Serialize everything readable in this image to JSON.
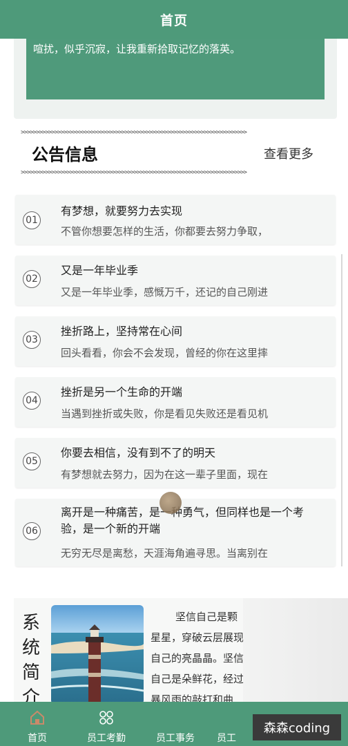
{
  "header": {
    "title": "首页"
  },
  "intro": {
    "text": "喧扰，似乎沉寂，让我重新拾取记忆的落英。"
  },
  "notice": {
    "arrows": ">>>>>>>>>>>>>>>>>>>>>>>>>>>>>>>>>>>>>>>>>>>>>>>>>>>>>>>>>>>>>>>>>>>>>>>>>>",
    "title": "公告信息",
    "more": "查看更多",
    "items": [
      {
        "num": "01",
        "title": "有梦想，就要努力去实现",
        "desc": "不管你想要怎样的生活，你都要去努力争取，"
      },
      {
        "num": "02",
        "title": "又是一年毕业季",
        "desc": "又是一年毕业季，感慨万千，还记的自己刚进"
      },
      {
        "num": "03",
        "title": "挫折路上，坚持常在心间",
        "desc": "回头看看，你会不会发现，曾经的你在这里摔"
      },
      {
        "num": "04",
        "title": "挫折是另一个生命的开端",
        "desc": "当遇到挫折或失败，你是看见失败还是看见机"
      },
      {
        "num": "05",
        "title": "你要去相信，没有到不了的明天",
        "desc": "有梦想就去努力，因为在这一辈子里面，现在"
      },
      {
        "num": "06",
        "title": "离开是一种痛苦，是一种勇气，但同样也是一个考验，是一个新的开端",
        "desc": "无穷无尽是离愁，天涯海角遍寻思。当离别在"
      }
    ]
  },
  "system": {
    "vertical_title": "系统简介",
    "text": "坚信自己是颗星星，穿破云层展现自己的亮晶晶。坚信自己是朵鲜花，经过暴风雨的敲打和曲折，坚信自己的光芒能驱散浮云与阴霾。入社会，坚信你我"
  },
  "tabbar": {
    "tabs": [
      {
        "label": "首页",
        "icon": "home-icon"
      },
      {
        "label": "员工考勤",
        "icon": "grid-icon"
      },
      {
        "label": "员工事务",
        "icon": "briefcase-icon"
      },
      {
        "label": "员工",
        "icon": "user-icon"
      }
    ]
  },
  "watermark": "森森coding",
  "colors": {
    "primary": "#4e9a7a",
    "card_bg": "#f4f6f5"
  }
}
